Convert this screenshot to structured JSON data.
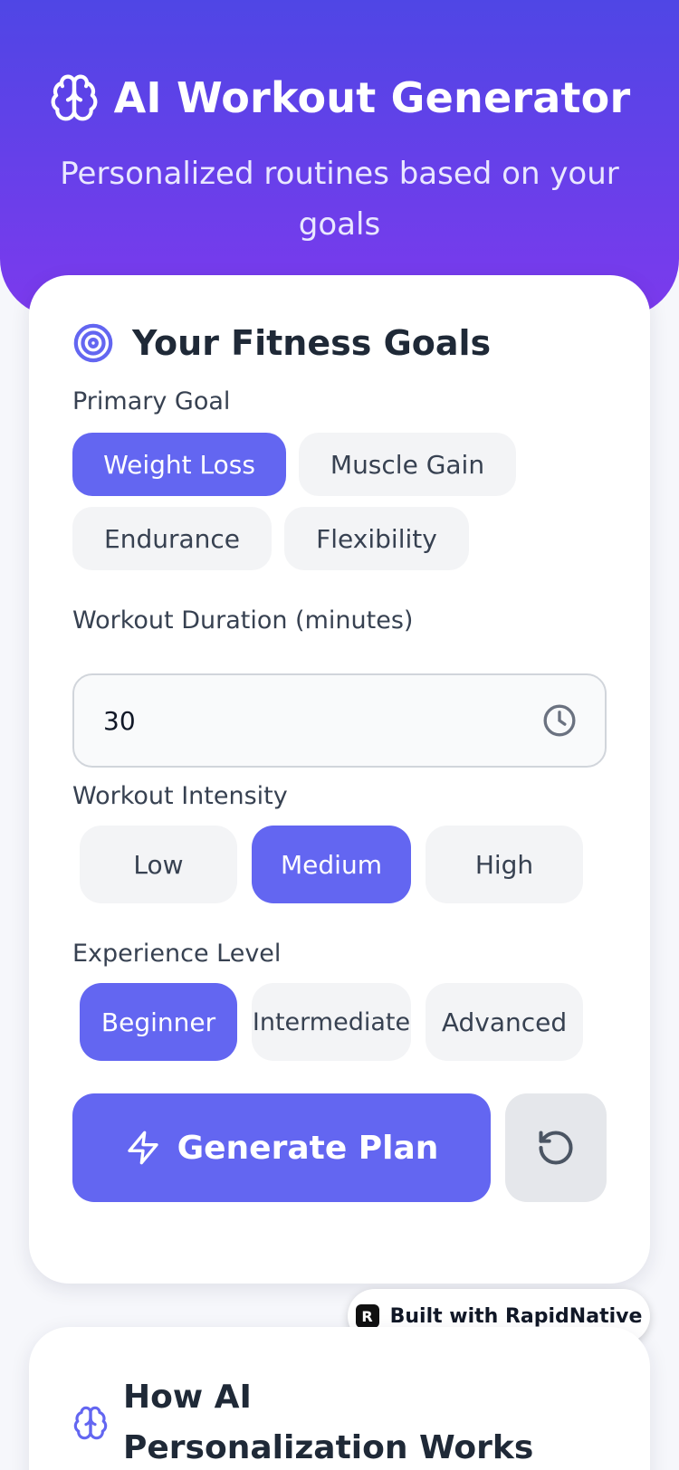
{
  "header": {
    "icon": "brain-icon",
    "title": "AI Workout Generator",
    "subtitle": "Personalized routines based on your goals"
  },
  "goals_card": {
    "icon": "target-icon",
    "title": "Your Fitness Goals",
    "primary_goal": {
      "label": "Primary Goal",
      "options": [
        "Weight Loss",
        "Muscle Gain",
        "Endurance",
        "Flexibility"
      ],
      "selected": "Weight Loss"
    },
    "duration": {
      "label": "Workout Duration (minutes)",
      "value": "30",
      "icon": "clock-icon"
    },
    "intensity": {
      "label": "Workout Intensity",
      "options": [
        "Low",
        "Medium",
        "High"
      ],
      "selected": "Medium"
    },
    "experience": {
      "label": "Experience Level",
      "options": [
        "Beginner",
        "Intermediate",
        "Advanced"
      ],
      "selected": "Beginner"
    },
    "generate_button": {
      "label": "Generate Plan",
      "icon": "lightning-icon"
    },
    "reset_button": {
      "icon": "reset-icon"
    }
  },
  "badge": {
    "text": "Built with RapidNative",
    "logo": "R"
  },
  "info_card": {
    "icon": "brain-icon",
    "title": "How AI Personalization Works"
  },
  "colors": {
    "accent": "#6366f1",
    "header_gradient_top": "#4f46e5",
    "header_gradient_bottom": "#7c3aed",
    "chip_inactive": "#f3f4f6"
  }
}
